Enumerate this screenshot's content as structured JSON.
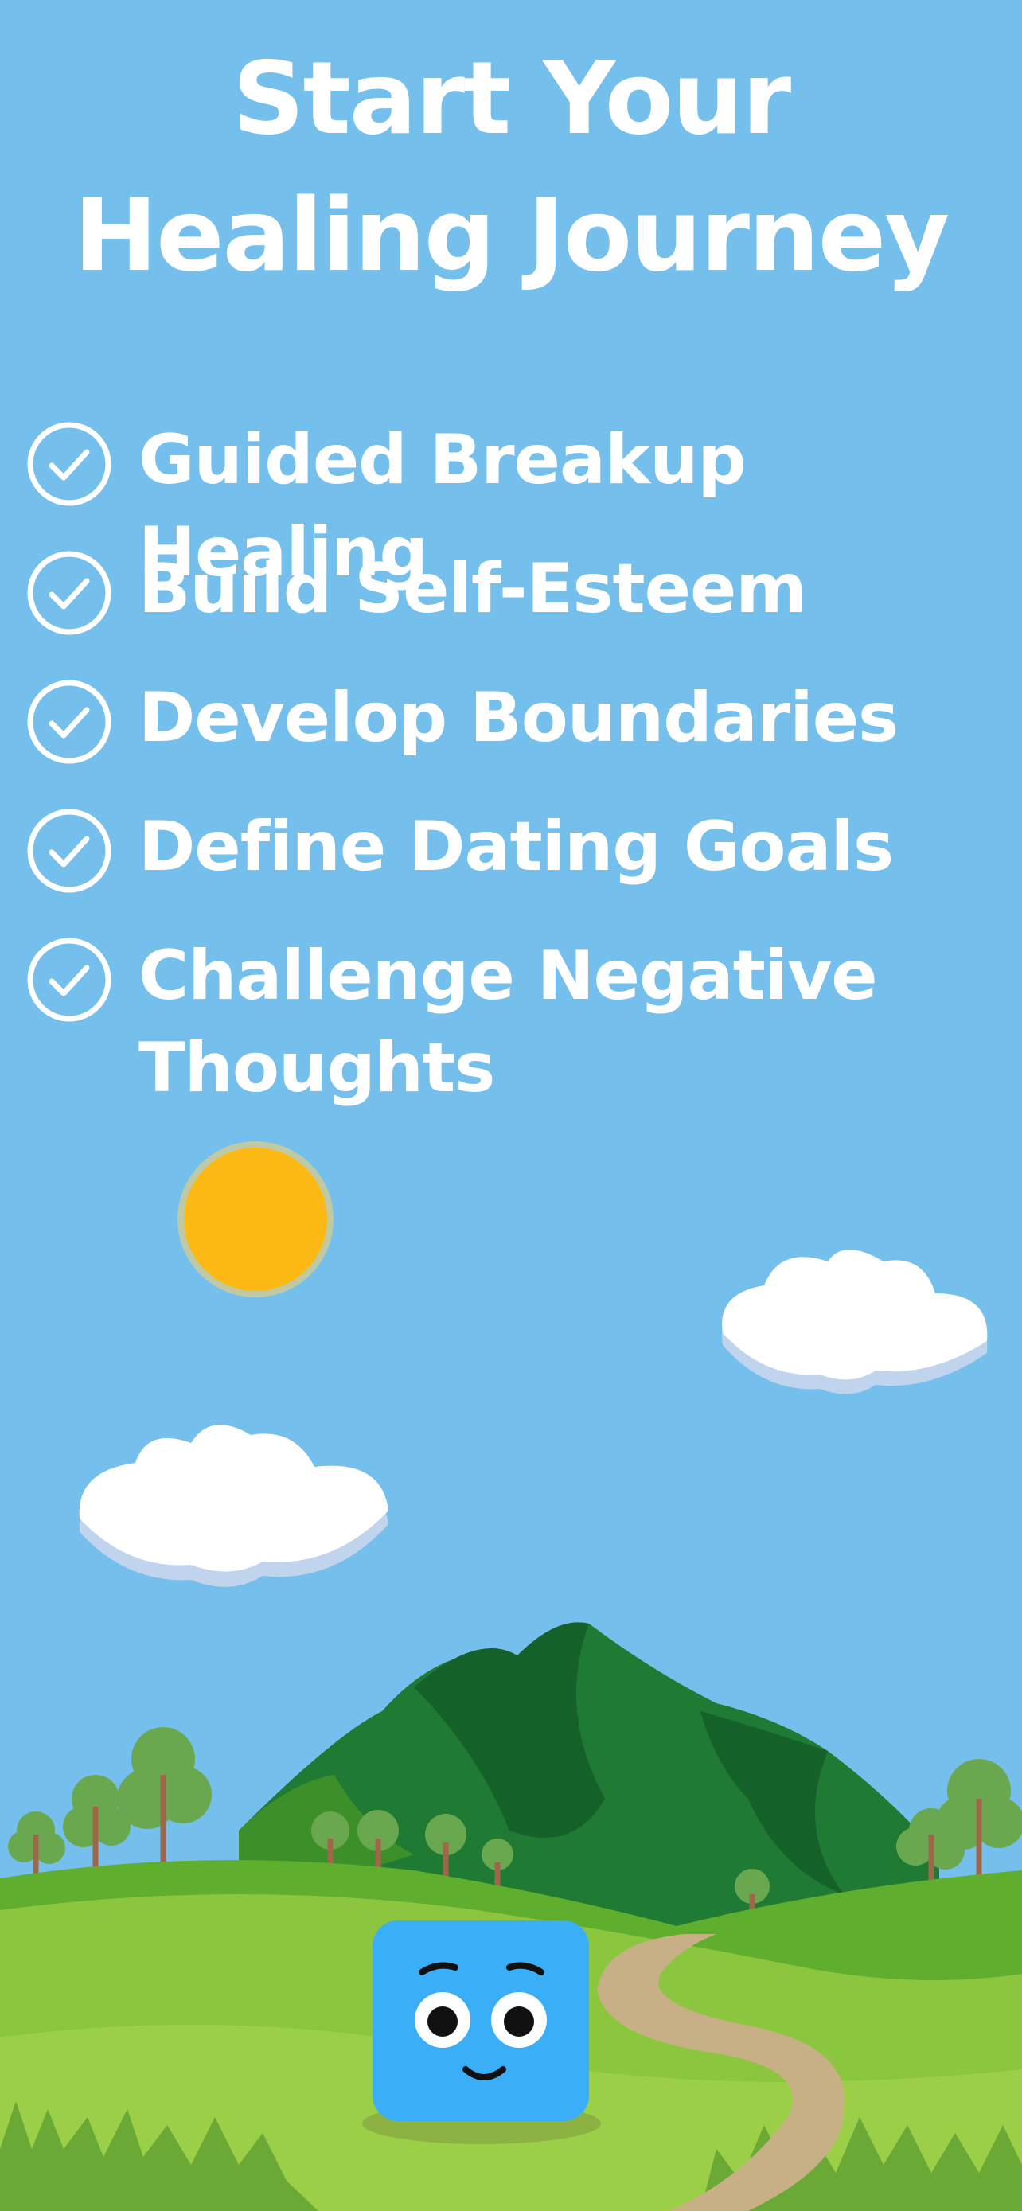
{
  "title": {
    "line1": "Start Your",
    "line2": "Healing Journey"
  },
  "features": [
    {
      "label": "Guided Breakup Healing",
      "icon": "check-circle-icon"
    },
    {
      "label": "Build Self-Esteem",
      "icon": "check-circle-icon"
    },
    {
      "label": "Develop Boundaries",
      "icon": "check-circle-icon"
    },
    {
      "label": "Define Dating Goals",
      "icon": "check-circle-icon"
    },
    {
      "label": "Challenge Negative Thoughts",
      "icon": "check-circle-icon"
    }
  ],
  "colors": {
    "sky": "#74bfec",
    "text": "#ffffff",
    "sun": "#fdb913",
    "mountain": "#1f7a34",
    "grass": "#8cc63f",
    "path": "#c8b086",
    "mascot": "#3aaef6"
  },
  "illustration": {
    "elements": [
      "sun",
      "cloud",
      "cloud",
      "mountain",
      "trees",
      "hills",
      "path",
      "mascot"
    ]
  }
}
